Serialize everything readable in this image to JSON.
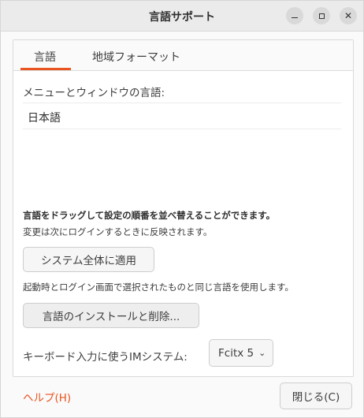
{
  "window": {
    "title": "言語サポート",
    "controls": {
      "minimize": "minimize",
      "maximize": "maximize",
      "close": "✕"
    }
  },
  "tabs": [
    {
      "label": "言語",
      "active": true
    },
    {
      "label": "地域フォーマット",
      "active": false
    }
  ],
  "language_tab": {
    "menu_label": "メニューとウィンドウの言語:",
    "languages": [
      "日本語"
    ],
    "drag_hint": "言語をドラッグして設定の順番を並べ替えることができます。",
    "relogin_note": "変更は次にログインするときに反映されます。",
    "apply_button": "システム全体に適用",
    "apply_note": "起動時とログイン画面で選択されたものと同じ言語を使用します。",
    "install_button": "言語のインストールと削除...",
    "im_label": "キーボード入力に使うIMシステム:",
    "im_value": "Fcitx 5"
  },
  "footer": {
    "help": "ヘルプ(H)",
    "close": "閉じる(C)"
  },
  "colors": {
    "accent": "#e95420"
  }
}
